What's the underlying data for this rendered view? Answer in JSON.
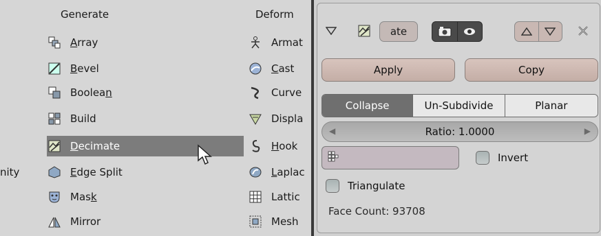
{
  "menu": {
    "generate_header": "Generate",
    "deform_header": "Deform",
    "cut_left_text": "nity",
    "generate_items": [
      {
        "pre": "",
        "u": "A",
        "post": "rray",
        "icon": "array-icon"
      },
      {
        "pre": "",
        "u": "B",
        "post": "evel",
        "icon": "bevel-icon"
      },
      {
        "pre": "Boolea",
        "u": "n",
        "post": "",
        "icon": "boolean-icon"
      },
      {
        "pre": "Build",
        "u": "",
        "post": "",
        "icon": "build-icon"
      },
      {
        "pre": "",
        "u": "D",
        "post": "ecimate",
        "icon": "decimate-icon",
        "selected": true
      },
      {
        "pre": "",
        "u": "E",
        "post": "dge Split",
        "icon": "edge-split-icon"
      },
      {
        "pre": "Mas",
        "u": "k",
        "post": "",
        "icon": "mask-icon"
      },
      {
        "pre": "Mirror",
        "u": "",
        "post": "",
        "icon": "mirror-icon"
      }
    ],
    "deform_items": [
      {
        "pre": "Armat",
        "u": "",
        "post": "",
        "icon": "armature-icon"
      },
      {
        "pre": "",
        "u": "C",
        "post": "ast",
        "icon": "cast-icon"
      },
      {
        "pre": "Curve",
        "u": "",
        "post": "",
        "icon": "curve-icon"
      },
      {
        "pre": "Displa",
        "u": "",
        "post": "",
        "icon": "displace-icon"
      },
      {
        "pre": "",
        "u": "H",
        "post": "ook",
        "icon": "hook-icon"
      },
      {
        "pre": "",
        "u": "L",
        "post": "aplac",
        "icon": "laplacian-icon"
      },
      {
        "pre": "Lattic",
        "u": "",
        "post": "",
        "icon": "lattice-icon"
      },
      {
        "pre": "Mesh",
        "u": "",
        "post": "",
        "icon": "mesh-deform-icon"
      }
    ]
  },
  "modifier": {
    "name_value": "ate",
    "apply_label": "Apply",
    "copy_label": "Copy",
    "modes": [
      {
        "label": "Collapse",
        "active": true
      },
      {
        "label": "Un-Subdivide",
        "active": false
      },
      {
        "label": "Planar",
        "active": false
      }
    ],
    "ratio_label": "Ratio: 1.0000",
    "invert_label": "Invert",
    "triangulate_label": "Triangulate",
    "face_count": "Face Count: 93708"
  },
  "colors": {
    "selected_bg": "#7c7c7c",
    "button_bg": "#c9b3ab",
    "active_mode_bg": "#6f6f6f"
  }
}
